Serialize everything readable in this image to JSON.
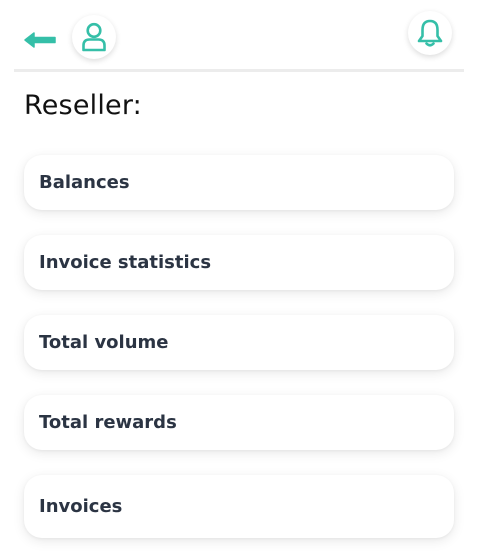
{
  "header": {
    "back_icon": "arrow-left-icon",
    "profile_icon": "user-icon",
    "bell_icon": "bell-icon",
    "accent_color": "#35bfa8"
  },
  "section": {
    "title": "Reseller:"
  },
  "menu": {
    "items": [
      {
        "label": "Balances"
      },
      {
        "label": "Invoice statistics"
      },
      {
        "label": "Total volume"
      },
      {
        "label": "Total rewards"
      },
      {
        "label": "Invoices"
      }
    ]
  }
}
